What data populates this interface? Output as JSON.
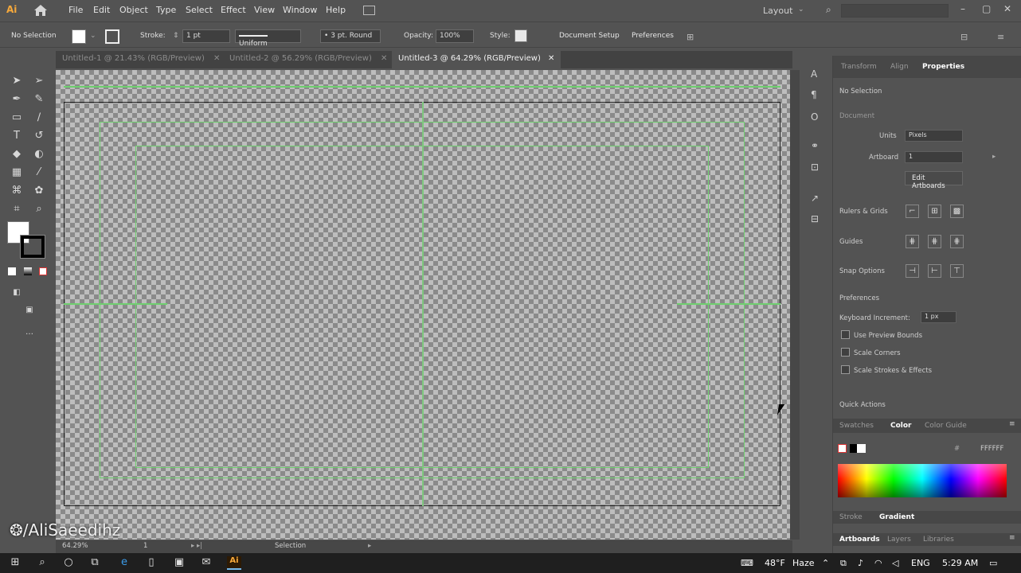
{
  "app": {
    "logo": "Ai"
  },
  "menu": [
    "File",
    "Edit",
    "Object",
    "Type",
    "Select",
    "Effect",
    "View",
    "Window",
    "Help"
  ],
  "layout_label": "Layout",
  "control_bar": {
    "selection": "No Selection",
    "stroke_label": "Stroke:",
    "stroke_value": "1 pt",
    "profile": "Uniform",
    "brush": "3 pt. Round",
    "opacity_label": "Opacity:",
    "opacity_value": "100%",
    "style_label": "Style:",
    "document_setup": "Document Setup",
    "preferences": "Preferences"
  },
  "tabs": [
    {
      "label": "Untitled-1 @ 21.43% (RGB/Preview)"
    },
    {
      "label": "Untitled-2 @ 56.29% (RGB/Preview)"
    },
    {
      "label": "Untitled-3 @ 64.29% (RGB/Preview)"
    }
  ],
  "panel": {
    "tabs": [
      "Transform",
      "Align",
      "Properties"
    ],
    "no_selection": "No Selection",
    "document_label": "Document",
    "units_label": "Units",
    "units_value": "Pixels",
    "artboard_label": "Artboard",
    "artboard_value": "1",
    "edit_artboards": "Edit Artboards",
    "rulers_grids": "Rulers & Grids",
    "guides": "Guides",
    "snap_options": "Snap Options",
    "preferences": "Preferences",
    "keyboard_increment_label": "Keyboard Increment:",
    "keyboard_increment_value": "1 px",
    "use_preview_bounds": "Use Preview Bounds",
    "scale_corners": "Scale Corners",
    "scale_strokes": "Scale Strokes & Effects",
    "quick_actions": "Quick Actions",
    "color_tabs": [
      "Swatches",
      "Color",
      "Color Guide"
    ],
    "hex_value": "FFFFFF",
    "stroke_gradient_tabs": [
      "Stroke",
      "Gradient"
    ],
    "bottom_tabs": [
      "Artboards",
      "Layers",
      "Libraries"
    ]
  },
  "status": {
    "zoom": "64.29%",
    "artboard_num": "1",
    "tool": "Selection"
  },
  "watermark": "/AliSaeedihz",
  "taskbar": {
    "temp": "48°F",
    "weather": "Haze",
    "lang": "ENG",
    "time": "5:29 AM"
  }
}
